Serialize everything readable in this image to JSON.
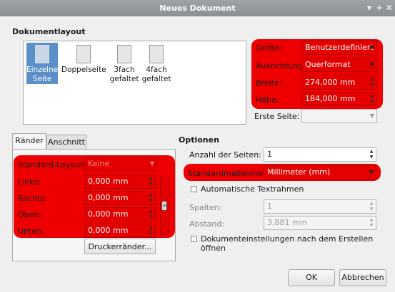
{
  "window": {
    "title": "Neues Dokument"
  },
  "layout_section": {
    "title": "Dokumentlayout",
    "options": [
      {
        "line1": "Einzelne",
        "line2": "Seite",
        "selected": true
      },
      {
        "line1": "Doppelseite",
        "line2": "",
        "selected": false
      },
      {
        "line1": "3fach",
        "line2": "gefaltet",
        "selected": false
      },
      {
        "line1": "4fach",
        "line2": "gefaltet",
        "selected": false
      }
    ]
  },
  "page_props": {
    "size_label": "Größe:",
    "size_value": "Benutzerdefiniert",
    "orientation_label": "Ausrichtung:",
    "orientation_value": "Querformat",
    "width_label": "Breite:",
    "width_value": "274,000 mm",
    "height_label": "Höhe:",
    "height_value": "184,000 mm",
    "first_page_label": "Erste Seite:",
    "first_page_value": ""
  },
  "tabs": {
    "margins": "Ränder",
    "bleed": "Anschnitt"
  },
  "margins": {
    "preset_label": "Standard-Layouts:",
    "preset_value": "Keine",
    "left_label": "Links:",
    "left_value": "0,000 mm",
    "right_label": "Rechts:",
    "right_value": "0,000 mm",
    "top_label": "Oben:",
    "top_value": "0,000 mm",
    "bottom_label": "Unten:",
    "bottom_value": "0,000 mm",
    "printer_button": "Druckerränder..."
  },
  "options": {
    "title": "Optionen",
    "pages_label": "Anzahl der Seiten:",
    "pages_value": "1",
    "unit_label": "Standardmaßeinheit:",
    "unit_value": "Millimeter (mm)",
    "auto_frames_label": "Automatische Textrahmen",
    "columns_label": "Spalten:",
    "columns_value": "1",
    "gap_label": "Abstand:",
    "gap_value": "3,881 mm",
    "open_settings_label": "Dokumenteinstellungen nach dem Erstellen öffnen"
  },
  "buttons": {
    "ok": "OK",
    "cancel": "Abbrechen"
  },
  "colors": {
    "highlight": "#ee0000",
    "selection": "#5a8fc7"
  }
}
